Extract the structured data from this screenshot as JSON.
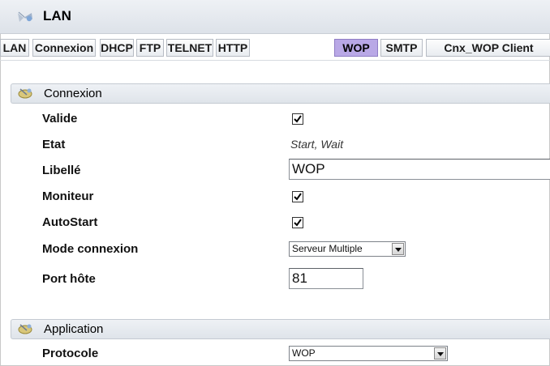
{
  "window": {
    "title": "LAN",
    "icon": "network-icon"
  },
  "tabs": [
    {
      "label": "LAN"
    },
    {
      "label": "Connexion"
    },
    {
      "label": "DHCP"
    },
    {
      "label": "FTP"
    },
    {
      "label": "TELNET"
    },
    {
      "label": "HTTP"
    },
    {
      "label": "WOP",
      "active": true
    },
    {
      "label": "SMTP"
    },
    {
      "label": "Cnx_WOP Client"
    }
  ],
  "sections": {
    "connexion": {
      "title": "Connexion",
      "icon": "satellite-icon"
    },
    "application": {
      "title": "Application",
      "icon": "satellite-icon"
    }
  },
  "fields": {
    "valide": {
      "label": "Valide",
      "checked": true
    },
    "etat": {
      "label": "Etat",
      "value": "Start, Wait"
    },
    "libelle": {
      "label": "Libellé",
      "value": "WOP"
    },
    "moniteur": {
      "label": "Moniteur",
      "checked": true
    },
    "autostart": {
      "label": "AutoStart",
      "checked": true
    },
    "mode_connexion": {
      "label": "Mode connexion",
      "value": "Serveur Multiple"
    },
    "port_hote": {
      "label": "Port hôte",
      "value": "81"
    },
    "protocole": {
      "label": "Protocole",
      "value": "WOP"
    }
  },
  "colors": {
    "active_tab": "#b9a8e6",
    "header_bg": "#e6eaef"
  }
}
